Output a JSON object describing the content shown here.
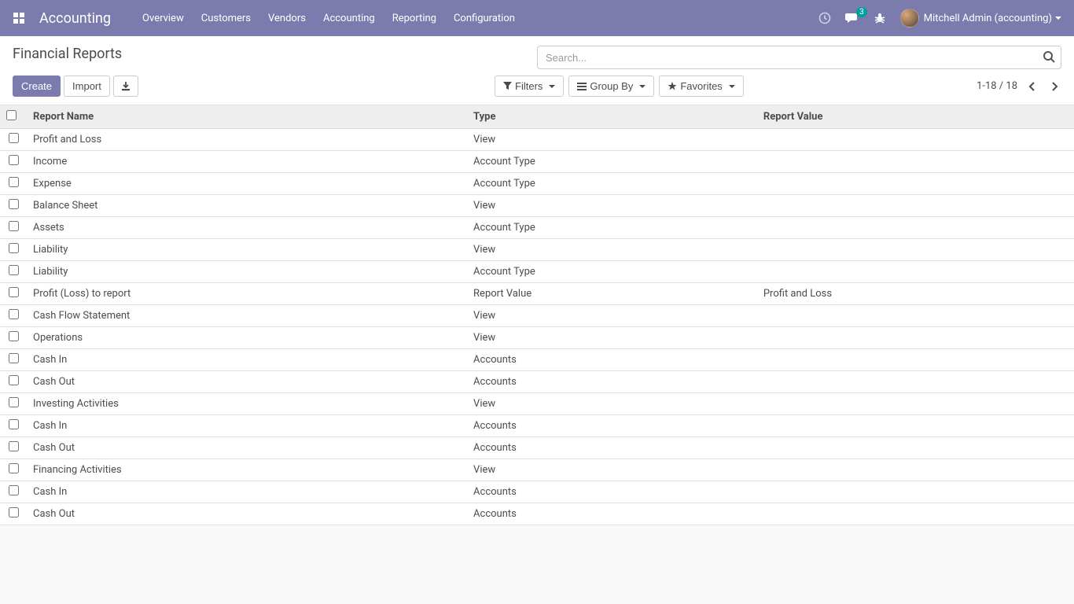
{
  "navbar": {
    "brand": "Accounting",
    "menu": [
      "Overview",
      "Customers",
      "Vendors",
      "Accounting",
      "Reporting",
      "Configuration"
    ],
    "message_count": "3",
    "user_label": "Mitchell Admin (accounting)"
  },
  "control_panel": {
    "title": "Financial Reports",
    "search_placeholder": "Search...",
    "create_label": "Create",
    "import_label": "Import",
    "filters_label": "Filters",
    "groupby_label": "Group By",
    "favorites_label": "Favorites",
    "pager_text": "1-18 / 18"
  },
  "table": {
    "headers": {
      "name": "Report Name",
      "type": "Type",
      "value": "Report Value"
    },
    "rows": [
      {
        "name": "Profit and Loss",
        "type": "View",
        "value": ""
      },
      {
        "name": "Income",
        "type": "Account Type",
        "value": ""
      },
      {
        "name": "Expense",
        "type": "Account Type",
        "value": ""
      },
      {
        "name": "Balance Sheet",
        "type": "View",
        "value": ""
      },
      {
        "name": "Assets",
        "type": "Account Type",
        "value": ""
      },
      {
        "name": "Liability",
        "type": "View",
        "value": ""
      },
      {
        "name": "Liability",
        "type": "Account Type",
        "value": ""
      },
      {
        "name": "Profit (Loss) to report",
        "type": "Report Value",
        "value": "Profit and Loss"
      },
      {
        "name": "Cash Flow Statement",
        "type": "View",
        "value": ""
      },
      {
        "name": "Operations",
        "type": "View",
        "value": ""
      },
      {
        "name": "Cash In",
        "type": "Accounts",
        "value": ""
      },
      {
        "name": "Cash Out",
        "type": "Accounts",
        "value": ""
      },
      {
        "name": "Investing Activities",
        "type": "View",
        "value": ""
      },
      {
        "name": "Cash In",
        "type": "Accounts",
        "value": ""
      },
      {
        "name": "Cash Out",
        "type": "Accounts",
        "value": ""
      },
      {
        "name": "Financing Activities",
        "type": "View",
        "value": ""
      },
      {
        "name": "Cash In",
        "type": "Accounts",
        "value": ""
      },
      {
        "name": "Cash Out",
        "type": "Accounts",
        "value": ""
      }
    ]
  }
}
